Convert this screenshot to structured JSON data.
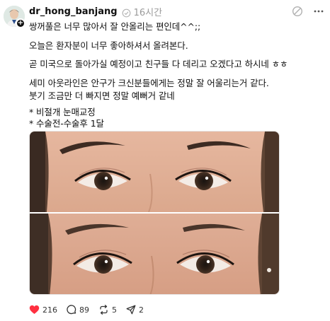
{
  "post": {
    "username": "dr_hong_banjang",
    "time": "16시간",
    "lines": [
      "쌍꺼풀은 너무 많아서 잘 안올리는 편인데^^;;",
      "오늘은 환자분이 너무 좋아하셔서 올려본다.",
      "곧 미국으로 돌아가실 예정이고 친구들 다 데리고 오겠다고 하시네 ㅎㅎ",
      "세미 아웃라인은 안구가 크신분들에게는 정말 잘 어울리는거 같다.",
      "붓기 조금만 더 빠지면 정말 예뻐거 같네",
      "* 비절개 눈매교정",
      "* 수술전-수술후 1달"
    ]
  },
  "actions": {
    "likes": "216",
    "comments": "89",
    "reposts": "5",
    "shares": "2"
  },
  "colors": {
    "like": "#ff3040",
    "muted": "#9a9a9a",
    "text": "#101010"
  },
  "icons": [
    "verified-icon",
    "heart-icon",
    "comment-icon",
    "repost-icon",
    "share-icon",
    "mute-icon",
    "more-icon"
  ]
}
